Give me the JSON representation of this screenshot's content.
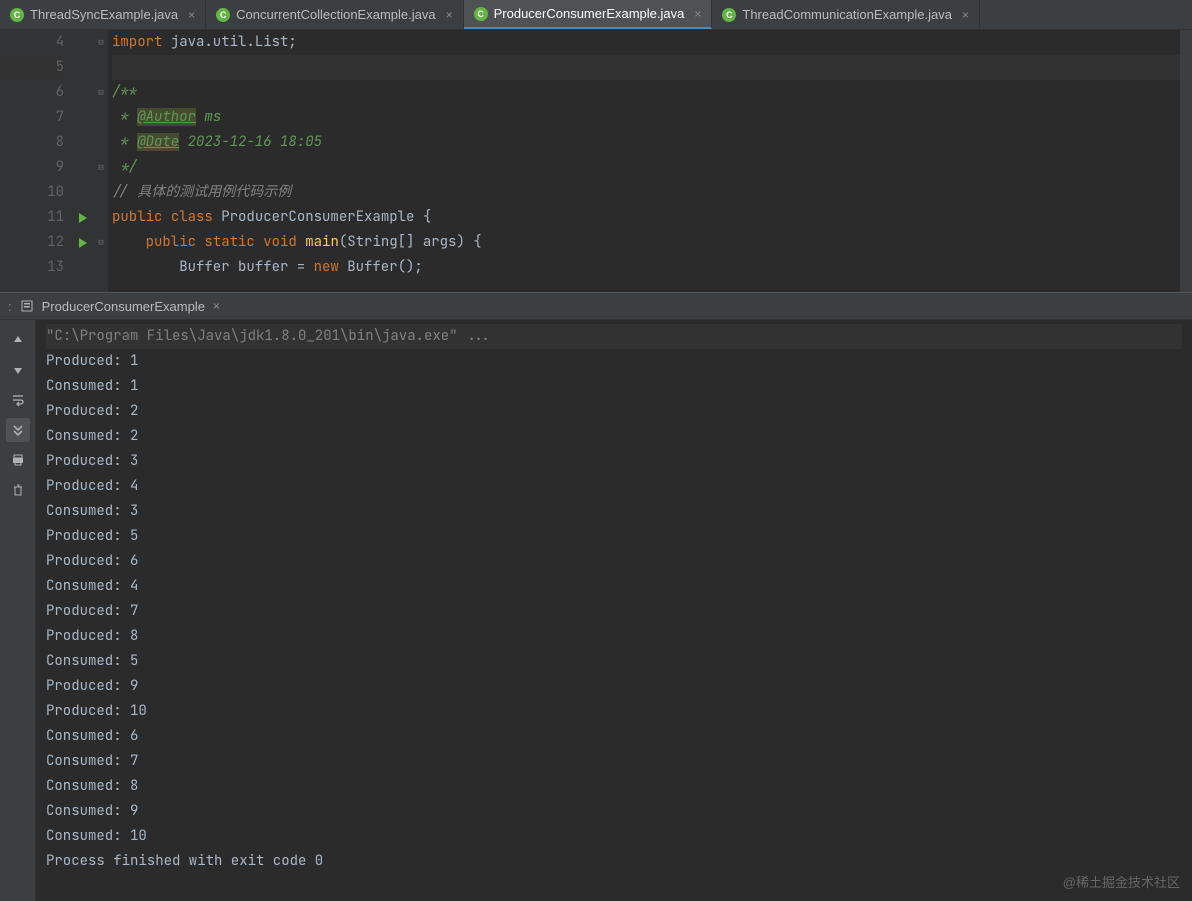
{
  "tabs": [
    {
      "label": "ThreadSyncExample.java",
      "active": false
    },
    {
      "label": "ConcurrentCollectionExample.java",
      "active": false
    },
    {
      "label": "ProducerConsumerExample.java",
      "active": true
    },
    {
      "label": "ThreadCommunicationExample.java",
      "active": false
    }
  ],
  "code": {
    "lines": [
      {
        "n": 4,
        "tokens": [
          {
            "cls": "kw",
            "t": "import"
          },
          {
            "cls": "p",
            "t": " java.util.List;"
          }
        ]
      },
      {
        "n": 5,
        "hl": true,
        "tokens": []
      },
      {
        "n": 6,
        "tokens": [
          {
            "cls": "cmt-doc",
            "t": "/**"
          }
        ]
      },
      {
        "n": 7,
        "tokens": [
          {
            "cls": "cmt-doc",
            "t": " * "
          },
          {
            "cls": "tag",
            "t": "@Author"
          },
          {
            "cls": "cmt-doc",
            "t": " ms"
          }
        ]
      },
      {
        "n": 8,
        "tokens": [
          {
            "cls": "cmt-doc",
            "t": " * "
          },
          {
            "cls": "tag",
            "t": "@Date"
          },
          {
            "cls": "cmt-doc",
            "t": " 2023-12-16 18:05"
          }
        ]
      },
      {
        "n": 9,
        "tokens": [
          {
            "cls": "cmt-doc",
            "t": " */"
          }
        ]
      },
      {
        "n": 10,
        "tokens": [
          {
            "cls": "cmt",
            "t": "// 具体的测试用例代码示例"
          }
        ]
      },
      {
        "n": 11,
        "run": true,
        "tokens": [
          {
            "cls": "kw",
            "t": "public"
          },
          {
            "cls": "p",
            "t": " "
          },
          {
            "cls": "kw",
            "t": "class"
          },
          {
            "cls": "p",
            "t": " "
          },
          {
            "cls": "cls",
            "t": "ProducerConsumerExample"
          },
          {
            "cls": "p",
            "t": " {"
          }
        ]
      },
      {
        "n": 12,
        "run": true,
        "tokens": [
          {
            "cls": "p",
            "t": "    "
          },
          {
            "cls": "kw",
            "t": "public"
          },
          {
            "cls": "p",
            "t": " "
          },
          {
            "cls": "kw",
            "t": "static"
          },
          {
            "cls": "p",
            "t": " "
          },
          {
            "cls": "kw",
            "t": "void"
          },
          {
            "cls": "p",
            "t": " "
          },
          {
            "cls": "func",
            "t": "main"
          },
          {
            "cls": "p",
            "t": "(String[] args) {"
          }
        ]
      },
      {
        "n": 13,
        "tokens": [
          {
            "cls": "p",
            "t": "        Buffer buffer = "
          },
          {
            "cls": "kw",
            "t": "new"
          },
          {
            "cls": "p",
            "t": " Buffer();"
          }
        ]
      }
    ]
  },
  "run_tab": {
    "label": "ProducerConsumerExample"
  },
  "console": {
    "cmd": "\"C:\\Program Files\\Java\\jdk1.8.0_201\\bin\\java.exe\" ...",
    "lines": [
      "Produced: 1",
      "Consumed: 1",
      "Produced: 2",
      "Consumed: 2",
      "Produced: 3",
      "Produced: 4",
      "Consumed: 3",
      "Produced: 5",
      "Produced: 6",
      "Consumed: 4",
      "Produced: 7",
      "Produced: 8",
      "Consumed: 5",
      "Produced: 9",
      "Produced: 10",
      "Consumed: 6",
      "Consumed: 7",
      "Consumed: 8",
      "Consumed: 9",
      "Consumed: 10",
      "",
      "Process finished with exit code 0"
    ]
  },
  "watermark": "@稀土掘金技术社区"
}
